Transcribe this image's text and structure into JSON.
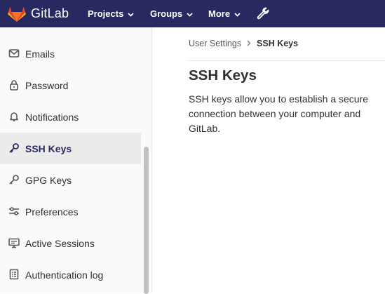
{
  "brand": {
    "name": "GitLab"
  },
  "topnav": {
    "projects": "Projects",
    "groups": "Groups",
    "more": "More"
  },
  "sidebar": {
    "items": [
      {
        "label": "Emails",
        "icon": "mail-icon"
      },
      {
        "label": "Password",
        "icon": "lock-icon"
      },
      {
        "label": "Notifications",
        "icon": "bell-icon"
      },
      {
        "label": "SSH Keys",
        "icon": "key-icon",
        "active": true
      },
      {
        "label": "GPG Keys",
        "icon": "key-icon"
      },
      {
        "label": "Preferences",
        "icon": "sliders-icon"
      },
      {
        "label": "Active Sessions",
        "icon": "monitor-icon"
      },
      {
        "label": "Authentication log",
        "icon": "log-icon"
      }
    ]
  },
  "breadcrumb": {
    "parent": "User Settings",
    "current": "SSH Keys"
  },
  "main": {
    "title": "SSH Keys",
    "description": "SSH keys allow you to establish a secure connection between your computer and GitLab."
  },
  "colors": {
    "topbar": "#292961",
    "active_text": "#292961",
    "sidebar_bg": "#fafafa",
    "active_bg": "#ebebeb"
  }
}
